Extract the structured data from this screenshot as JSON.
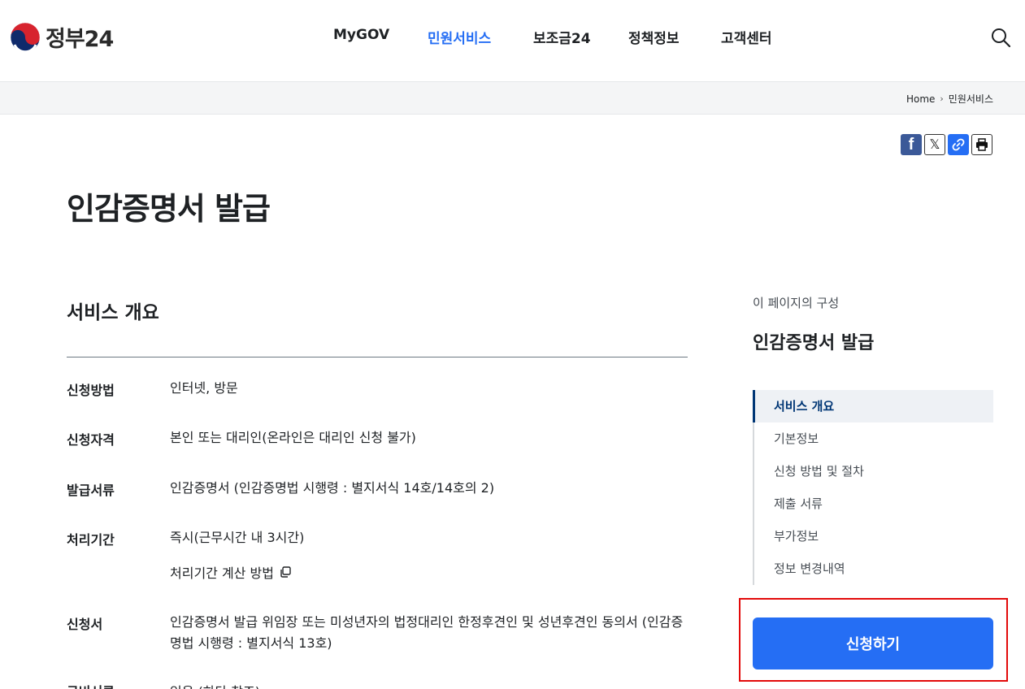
{
  "header": {
    "logo_text": "정부24",
    "nav": [
      {
        "label": "MyGOV",
        "active": false
      },
      {
        "label": "민원서비스",
        "active": true
      },
      {
        "label": "보조금24",
        "active": false
      },
      {
        "label": "정책정보",
        "active": false
      },
      {
        "label": "고객센터",
        "active": false
      }
    ],
    "search_icon": "search-icon"
  },
  "breadcrumb": {
    "home": "Home",
    "current": "민원서비스"
  },
  "share": {
    "facebook": "f",
    "x": "𝕏"
  },
  "page": {
    "title": "인감증명서 발급"
  },
  "overview": {
    "section_title": "서비스 개요",
    "rows": [
      {
        "label": "신청방법",
        "value": "인터넷, 방문"
      },
      {
        "label": "신청자격",
        "value": "본인 또는 대리인(온라인은 대리인 신청 불가)"
      },
      {
        "label": "발급서류",
        "value": "인감증명서 (인감증명법 시행령 : 별지서식 14호/14호의 2)"
      },
      {
        "label": "처리기간",
        "value": "즉시(근무시간 내 3시간)"
      },
      {
        "label": "신청서",
        "value": "인감증명서 발급 위임장 또는 미성년자의 법정대리인 한정후견인 및 성년후견인 동의서 (인감증명법 시행령 : 별지서식 13호)"
      }
    ],
    "calc_link": "처리기간 계산 방법",
    "cut_label": "구비서류",
    "cut_value": "있음 (하단 참조)"
  },
  "toc": {
    "caption": "이 페이지의 구성",
    "title": "인감증명서 발급",
    "items": [
      {
        "label": "서비스 개요",
        "active": true
      },
      {
        "label": "기본정보",
        "active": false
      },
      {
        "label": "신청 방법 및 절차",
        "active": false
      },
      {
        "label": "제출 서류",
        "active": false
      },
      {
        "label": "부가정보",
        "active": false
      },
      {
        "label": "정보 변경내역",
        "active": false
      }
    ]
  },
  "apply_button": "신청하기",
  "colors": {
    "accent": "#256ef4",
    "toc_active": "#003675",
    "highlight": "#e30a0a"
  }
}
